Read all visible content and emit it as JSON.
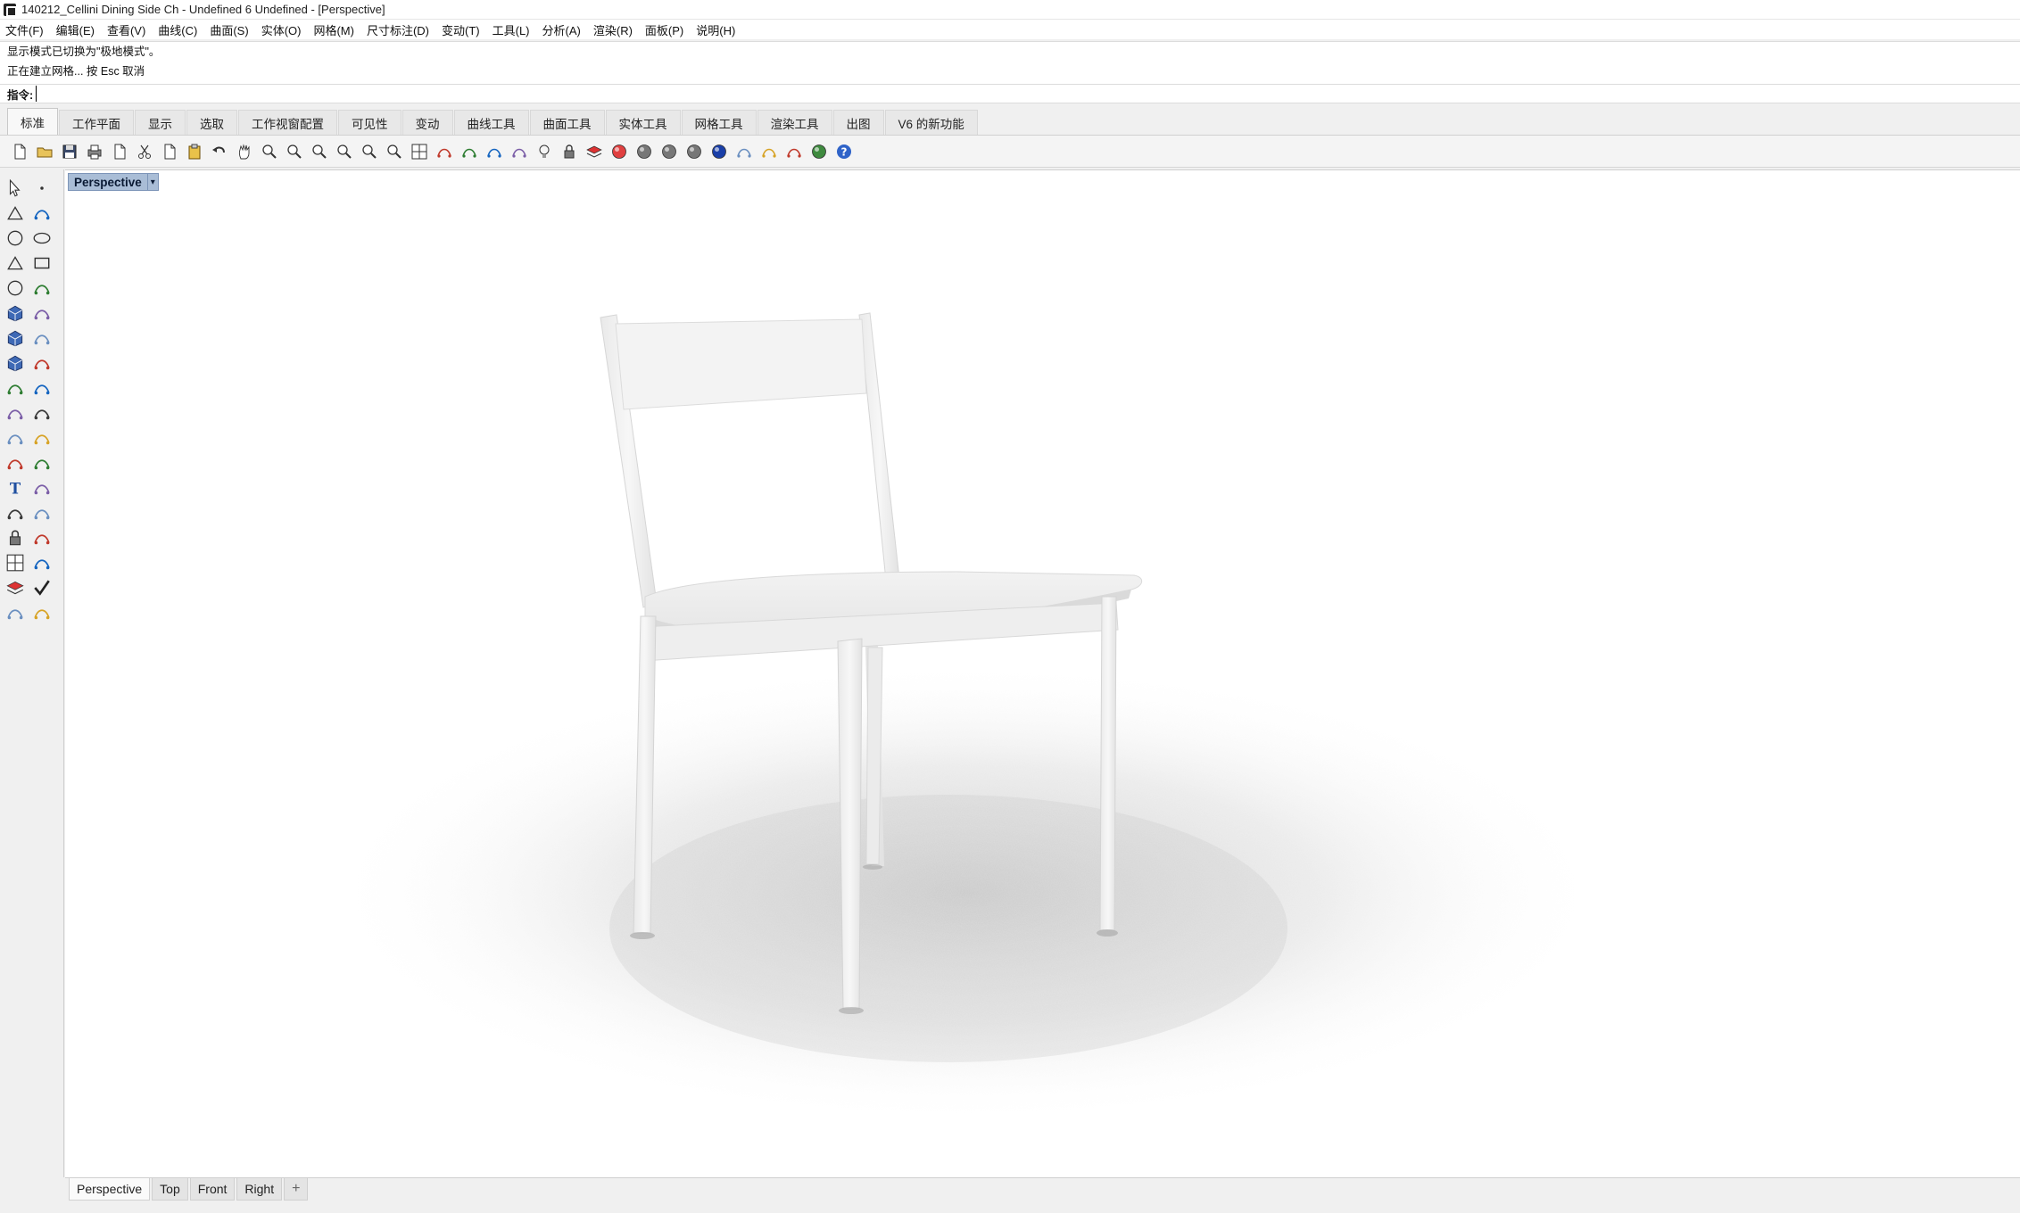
{
  "window": {
    "title": "140212_Cellini Dining Side Ch - Undefined 6 Undefined - [Perspective]"
  },
  "menu": [
    "文件(F)",
    "编辑(E)",
    "查看(V)",
    "曲线(C)",
    "曲面(S)",
    "实体(O)",
    "网格(M)",
    "尺寸标注(D)",
    "变动(T)",
    "工具(L)",
    "分析(A)",
    "渲染(R)",
    "面板(P)",
    "说明(H)"
  ],
  "command_history": [
    "显示模式已切换为\"极地模式\"。",
    "正在建立网格... 按 Esc 取消"
  ],
  "command": {
    "prompt": "指令:",
    "value": ""
  },
  "toolbar_tabs": [
    "标准",
    "工作平面",
    "显示",
    "选取",
    "工作视窗配置",
    "可见性",
    "变动",
    "曲线工具",
    "曲面工具",
    "实体工具",
    "网格工具",
    "渲染工具",
    "出图",
    "V6 的新功能"
  ],
  "active_toolbar_tab": "标准",
  "toolbar_icons": [
    "new-file-icon",
    "open-file-icon",
    "save-icon",
    "print-icon",
    "import-icon",
    "cut-icon",
    "copy-icon",
    "paste-icon",
    "undo-icon",
    "pan-hand-icon",
    "move-view-icon",
    "zoom-icon",
    "zoom-window-icon",
    "zoom-extents-icon",
    "zoom-selected-icon",
    "rotate-view-icon",
    "four-viewports-icon",
    "car-icon",
    "snapshot-icon",
    "named-view-icon",
    "osnap-icon",
    "light-bulb-icon",
    "lock-icon",
    "layer-icon",
    "color-wheel-icon",
    "shaded-sphere-icon",
    "rendered-sphere-icon",
    "sphere-icon",
    "blue-sphere-icon",
    "wand-icon",
    "gears-icon",
    "dimension-icon",
    "globe-icon",
    "help-icon"
  ],
  "left_tools": [
    "select-arrow-icon",
    "point-icon",
    "polyline-icon",
    "curve-icon",
    "circle-icon",
    "ellipse-icon",
    "triangle-icon",
    "rectangle-icon",
    "arc-icon",
    "fillet-curve-icon",
    "surface-icon",
    "revolve-icon",
    "box-icon",
    "boolean-icon",
    "cylinder-icon",
    "extrude-icon",
    "explode-icon",
    "split-icon",
    "trim-icon",
    "join-icon",
    "group-icon",
    "ungroup-icon",
    "curve-offset-icon",
    "blend-icon",
    "text-icon",
    "scale-icon",
    "array-icon",
    "mirror-icon",
    "block-icon",
    "dimension-tool-icon",
    "grid-array-icon",
    "analyze-icon",
    "layers-tool-icon",
    "check-icon",
    "render-tool-icon",
    "paint-icon"
  ],
  "viewport": {
    "label": "Perspective",
    "arrow": "▾"
  },
  "viewport_tabs": [
    "Perspective",
    "Top",
    "Front",
    "Right"
  ],
  "add_tab_symbol": "+",
  "active_viewport_tab": "Perspective"
}
